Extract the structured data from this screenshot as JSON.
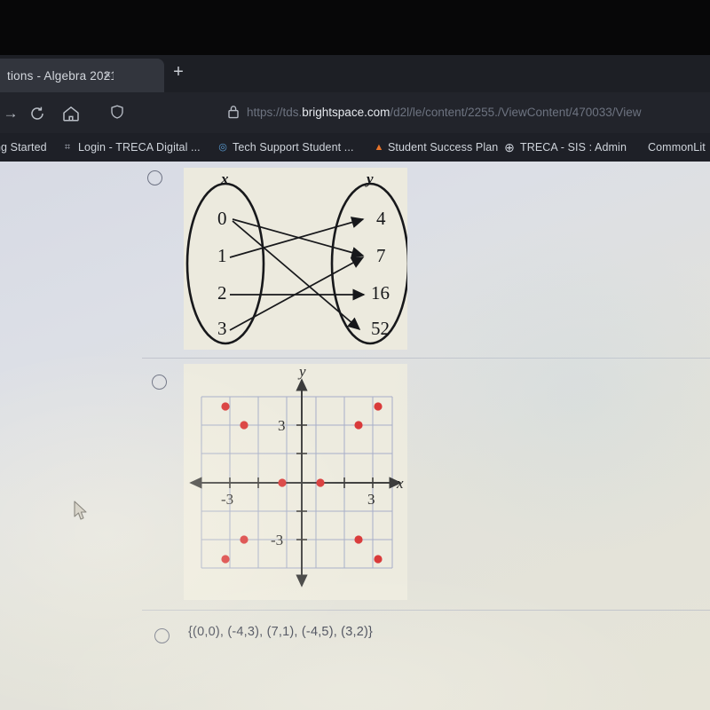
{
  "browser": {
    "tab": {
      "title": "tions - Algebra 2021",
      "close_glyph": "×"
    },
    "new_tab_glyph": "+",
    "nav": {
      "forward_glyph": "→",
      "reload_icon": "reload-icon",
      "home_icon": "home-icon",
      "shield_icon": "shield-icon",
      "lock_icon": "lock-icon"
    },
    "url": {
      "prefix": "https://tds.",
      "host": "brightspace.com",
      "path": "/d2l/le/content/2255./ViewContent/470033/View"
    },
    "bookmarks": [
      {
        "label": "ng Started",
        "icon": ""
      },
      {
        "label": "Login - TRECA Digital ...",
        "icon": "⌗"
      },
      {
        "label": "Tech Support Student ...",
        "icon": "◎"
      },
      {
        "label": "Student Success Plan",
        "icon": "▲"
      },
      {
        "label": "TRECA - SIS : Admin",
        "icon": "⊕"
      },
      {
        "label": "CommonLit",
        "icon": ""
      }
    ]
  },
  "question": {
    "options": [
      {
        "id": "option-1",
        "type": "mapping-diagram",
        "selected": false
      },
      {
        "id": "option-2",
        "type": "coordinate-graph",
        "selected": false
      },
      {
        "id": "option-3",
        "type": "text",
        "selected": false,
        "label": "{(0,0), (-4,3), (7,1), (-4,5), (3,2)}"
      }
    ]
  },
  "chart_data": [
    {
      "type": "diagram",
      "title": "Mapping diagram",
      "left_set_label": "x",
      "right_set_label": "y",
      "left_values": [
        "0",
        "1",
        "2",
        "3"
      ],
      "right_values": [
        "4",
        "7",
        "16",
        "52"
      ],
      "mappings": [
        {
          "from": "0",
          "to": "7"
        },
        {
          "from": "0",
          "to": "52"
        },
        {
          "from": "1",
          "to": "4"
        },
        {
          "from": "2",
          "to": "16"
        },
        {
          "from": "3",
          "to": "7"
        }
      ]
    },
    {
      "type": "scatter",
      "title": "",
      "xlabel": "x",
      "ylabel": "y",
      "xlim": [
        -5,
        5
      ],
      "ylim": [
        -5,
        5
      ],
      "xticks": [
        -3,
        3
      ],
      "yticks": [
        -3,
        3
      ],
      "xticklabels": [
        "-3",
        "3"
      ],
      "yticklabels": [
        "-3",
        "3"
      ],
      "grid": true,
      "point_color": "#d93a3a",
      "points": [
        {
          "x": -4,
          "y": 4
        },
        {
          "x": -3,
          "y": 3
        },
        {
          "x": -1,
          "y": 0
        },
        {
          "x": 1,
          "y": 0
        },
        {
          "x": 3,
          "y": 3
        },
        {
          "x": 4,
          "y": 4
        },
        {
          "x": -3,
          "y": -3
        },
        {
          "x": 3,
          "y": -3
        },
        {
          "x": -4,
          "y": -4
        },
        {
          "x": 4,
          "y": -4
        }
      ]
    }
  ],
  "colors": {
    "chrome_bg": "#22242b",
    "tab_bg": "#32353d",
    "page_bg": "#dcdfe6",
    "point_red": "#d93a3a",
    "ink": "#1a1a1a"
  }
}
